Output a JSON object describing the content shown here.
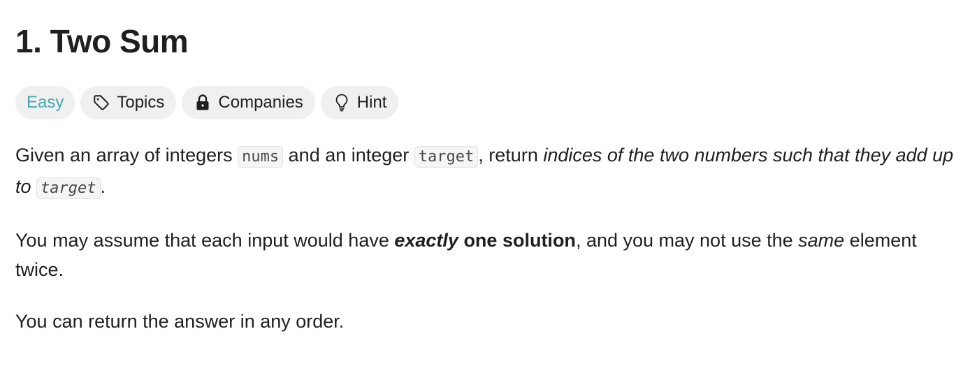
{
  "problem": {
    "title": "1. Two Sum",
    "difficulty": "Easy",
    "tags": {
      "topics": "Topics",
      "companies": "Companies",
      "hint": "Hint"
    },
    "colors": {
      "easy": "#46a9b3",
      "text": "#1f1f1f",
      "chip_bg": "#f0f0f0"
    },
    "icons": {
      "topics": "tag-icon",
      "companies": "lock-icon",
      "hint": "lightbulb-icon"
    },
    "paragraph1": {
      "t1": "Given an array of integers ",
      "code1": "nums",
      "t2": " and an integer ",
      "code2": "target",
      "t3": ", return ",
      "em1": "indices of the two numbers such that they add up to ",
      "code3": "target",
      "t4": "."
    },
    "paragraph2": {
      "t1": "You may assume that each input would have ",
      "em_strong": "exactly",
      "strong": " one solution",
      "t2": ", and you may not use the ",
      "em": "same",
      "t3": " element twice."
    },
    "paragraph3": "You can return the answer in any order."
  }
}
